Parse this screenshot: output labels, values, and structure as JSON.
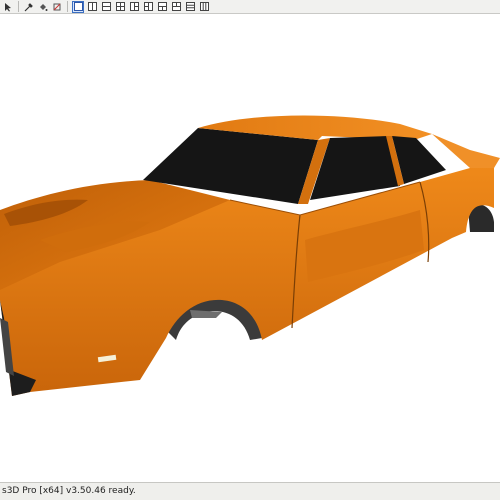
{
  "toolbar": {
    "buttons": [
      {
        "icon": "arrow-icon"
      },
      {
        "icon": "eyedropper-icon"
      },
      {
        "icon": "paint-bucket-icon"
      },
      {
        "icon": "clear-style-icon"
      },
      {
        "icon": "view-single-icon",
        "active": true
      },
      {
        "icon": "view-split-vertical-icon"
      },
      {
        "icon": "view-split-horizontal-icon"
      },
      {
        "icon": "view-grid-icon"
      },
      {
        "icon": "view-three-left-icon"
      },
      {
        "icon": "view-three-right-icon"
      },
      {
        "icon": "view-three-top-icon"
      },
      {
        "icon": "view-three-bottom-icon"
      },
      {
        "icon": "view-rows-icon"
      },
      {
        "icon": "view-columns-icon"
      }
    ]
  },
  "status": {
    "text": "s3D Pro [x64] v3.50.46 ready."
  },
  "colors": {
    "body_orange": "#e07a10",
    "body_dark": "#b45a05",
    "glass": "#151515",
    "accent": "#3b6fc2"
  }
}
